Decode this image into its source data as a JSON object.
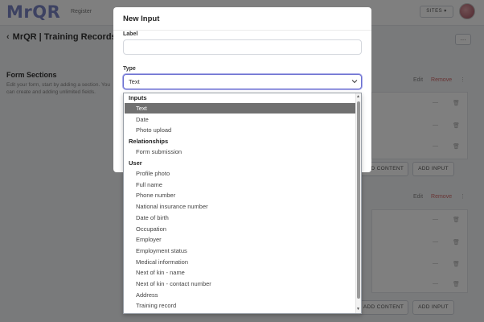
{
  "header": {
    "logo": "MrQR",
    "nav_register": "Register",
    "sites_button": "SITES ▾"
  },
  "page": {
    "back_icon": "‹",
    "title": "MrQR | Training Records",
    "more_button": "…"
  },
  "form_sections": {
    "title": "Form Sections",
    "description": "Edit your form, start by adding a section. You can create and adding unlimited fields.",
    "edit_label": "Edit",
    "remove_label": "Remove",
    "drag_icon": "⋮",
    "row_dash": "—",
    "row_trash": "🗑",
    "add_content_label": "ADD CONTENT",
    "add_input_label": "ADD INPUT"
  },
  "modal": {
    "title": "New Input",
    "label_field_label": "Label",
    "label_field_value": "",
    "type_field_label": "Type",
    "type_selected": "Text"
  },
  "dropdown": {
    "groups": [
      {
        "label": "Inputs",
        "items": [
          "Text",
          "Date",
          "Photo upload"
        ]
      },
      {
        "label": "Relationships",
        "items": [
          "Form submission"
        ]
      },
      {
        "label": "User",
        "items": [
          "Profile photo",
          "Full name",
          "Phone number",
          "National insurance number",
          "Date of birth",
          "Occupation",
          "Employer",
          "Employment status",
          "Medical information",
          "Next of kin - name",
          "Next of kin - contact number",
          "Address",
          "Training record"
        ]
      }
    ],
    "selected": "Text",
    "scroll_up": "▲",
    "scroll_down": "▼"
  },
  "colors": {
    "accent": "#6b6fd0",
    "selected_bg": "#707070",
    "remove": "#d26a6a"
  }
}
